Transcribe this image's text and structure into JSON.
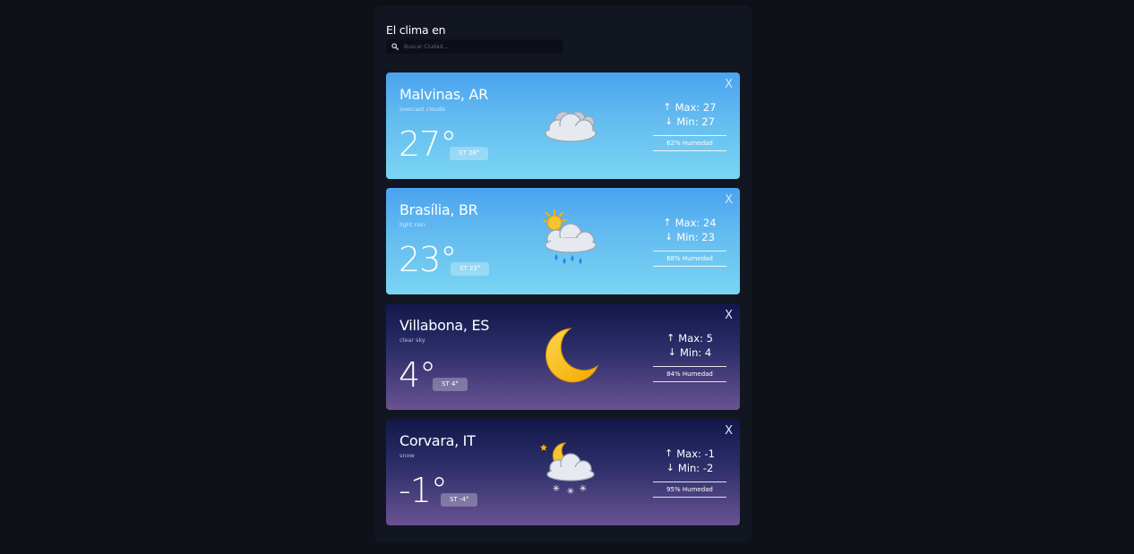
{
  "header": {
    "title": "El clima en",
    "search_placeholder": "Buscar Ciudad...",
    "search_icon": "search-icon"
  },
  "cards": [
    {
      "theme": "day",
      "city": "Malvinas, AR",
      "description": "overcast clouds",
      "temp": "27°",
      "feels": "ST 28°",
      "max": "Max: 27",
      "min": "Min: 27",
      "humidity": "62% Humedad",
      "icon": "overcast-clouds-icon",
      "close": "X"
    },
    {
      "theme": "day",
      "city": "Brasília, BR",
      "description": "light rain",
      "temp": "23°",
      "feels": "ST 23°",
      "max": "Max: 24",
      "min": "Min: 23",
      "humidity": "68% Humedad",
      "icon": "sun-rain-cloud-icon",
      "close": "X"
    },
    {
      "theme": "night",
      "city": "Villabona, ES",
      "description": "clear sky",
      "temp": "4°",
      "feels": "ST 4°",
      "max": "Max: 5",
      "min": "Min: 4",
      "humidity": "84% Humedad",
      "icon": "moon-icon",
      "close": "X"
    },
    {
      "theme": "night",
      "city": "Corvara, IT",
      "description": "snow",
      "temp": "-1°",
      "feels": "ST -4°",
      "max": "Max: -1",
      "min": "Min: -2",
      "humidity": "95% Humedad",
      "icon": "moon-snow-cloud-icon",
      "close": "X"
    }
  ],
  "arrows": {
    "up": "↑",
    "down": "↓"
  },
  "colors": {
    "background": "#0e1117",
    "panel": "#121620",
    "day_top": "#4aa3ef",
    "day_bottom": "#7ad5f2",
    "night_top": "#12174a",
    "night_bottom": "#6a5292"
  }
}
